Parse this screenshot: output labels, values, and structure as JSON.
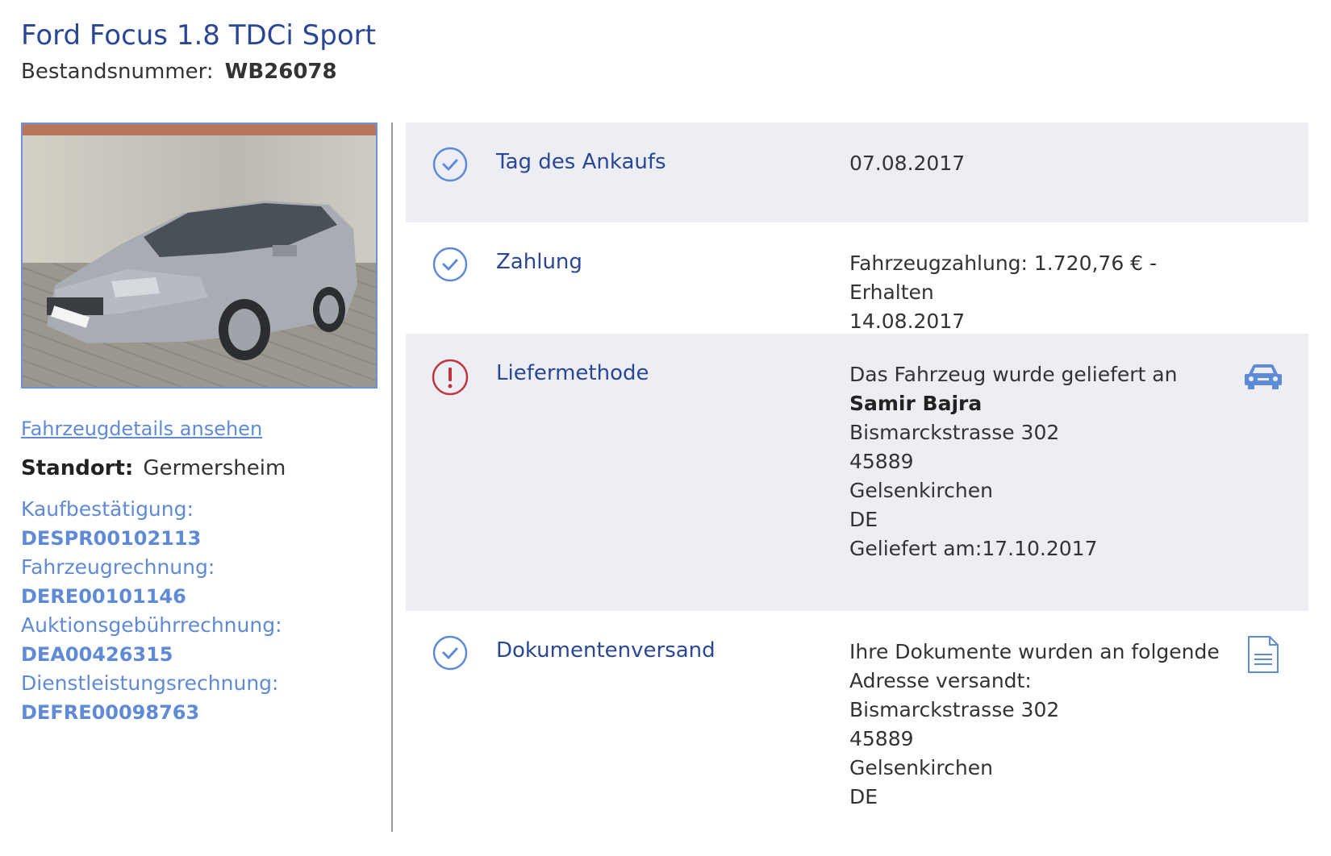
{
  "header": {
    "title": "Ford Focus 1.8 TDCi Sport",
    "stock_label": "Bestandsnummer:",
    "stock_value": "WB26078"
  },
  "sidebar": {
    "details_link": "Fahrzeugdetails ansehen",
    "location_label": "Standort:",
    "location_value": "Germersheim",
    "documents": [
      {
        "label": "Kaufbestätigung:",
        "number": "DESPR00102113"
      },
      {
        "label": "Fahrzeugrechnung:",
        "number": "DERE00101146"
      },
      {
        "label": "Auktionsgebührrechnung:",
        "number": "DEA00426315"
      },
      {
        "label": "Dienstleistungsrechnung:",
        "number": "DEFRE00098763"
      }
    ]
  },
  "steps": [
    {
      "status": "done",
      "title": "Tag des Ankaufs",
      "lines": [
        "07.08.2017"
      ]
    },
    {
      "status": "done",
      "title": "Zahlung",
      "lines": [
        "Fahrzeugzahlung: 1.720,76 € - Erhalten",
        "14.08.2017"
      ]
    },
    {
      "status": "warning",
      "title": "Liefermethode",
      "lines": [
        "Das Fahrzeug wurde geliefert an",
        "Samir Bajra",
        "Bismarckstrasse 302",
        "45889",
        "Gelsenkirchen",
        "DE",
        "Geliefert am:17.10.2017"
      ],
      "right_icon": "car-icon"
    },
    {
      "status": "done",
      "title": "Dokumentenversand",
      "lines": [
        "Ihre Dokumente wurden an folgende",
        "Adresse versandt:",
        "Bismarckstrasse 302",
        "45889",
        "Gelsenkirchen",
        "DE"
      ],
      "right_icon": "document-icon"
    }
  ],
  "colors": {
    "accent": "#2a4795",
    "link": "#5f8ad6",
    "warning": "#c0333f",
    "panel_grey": "#eceef3"
  }
}
